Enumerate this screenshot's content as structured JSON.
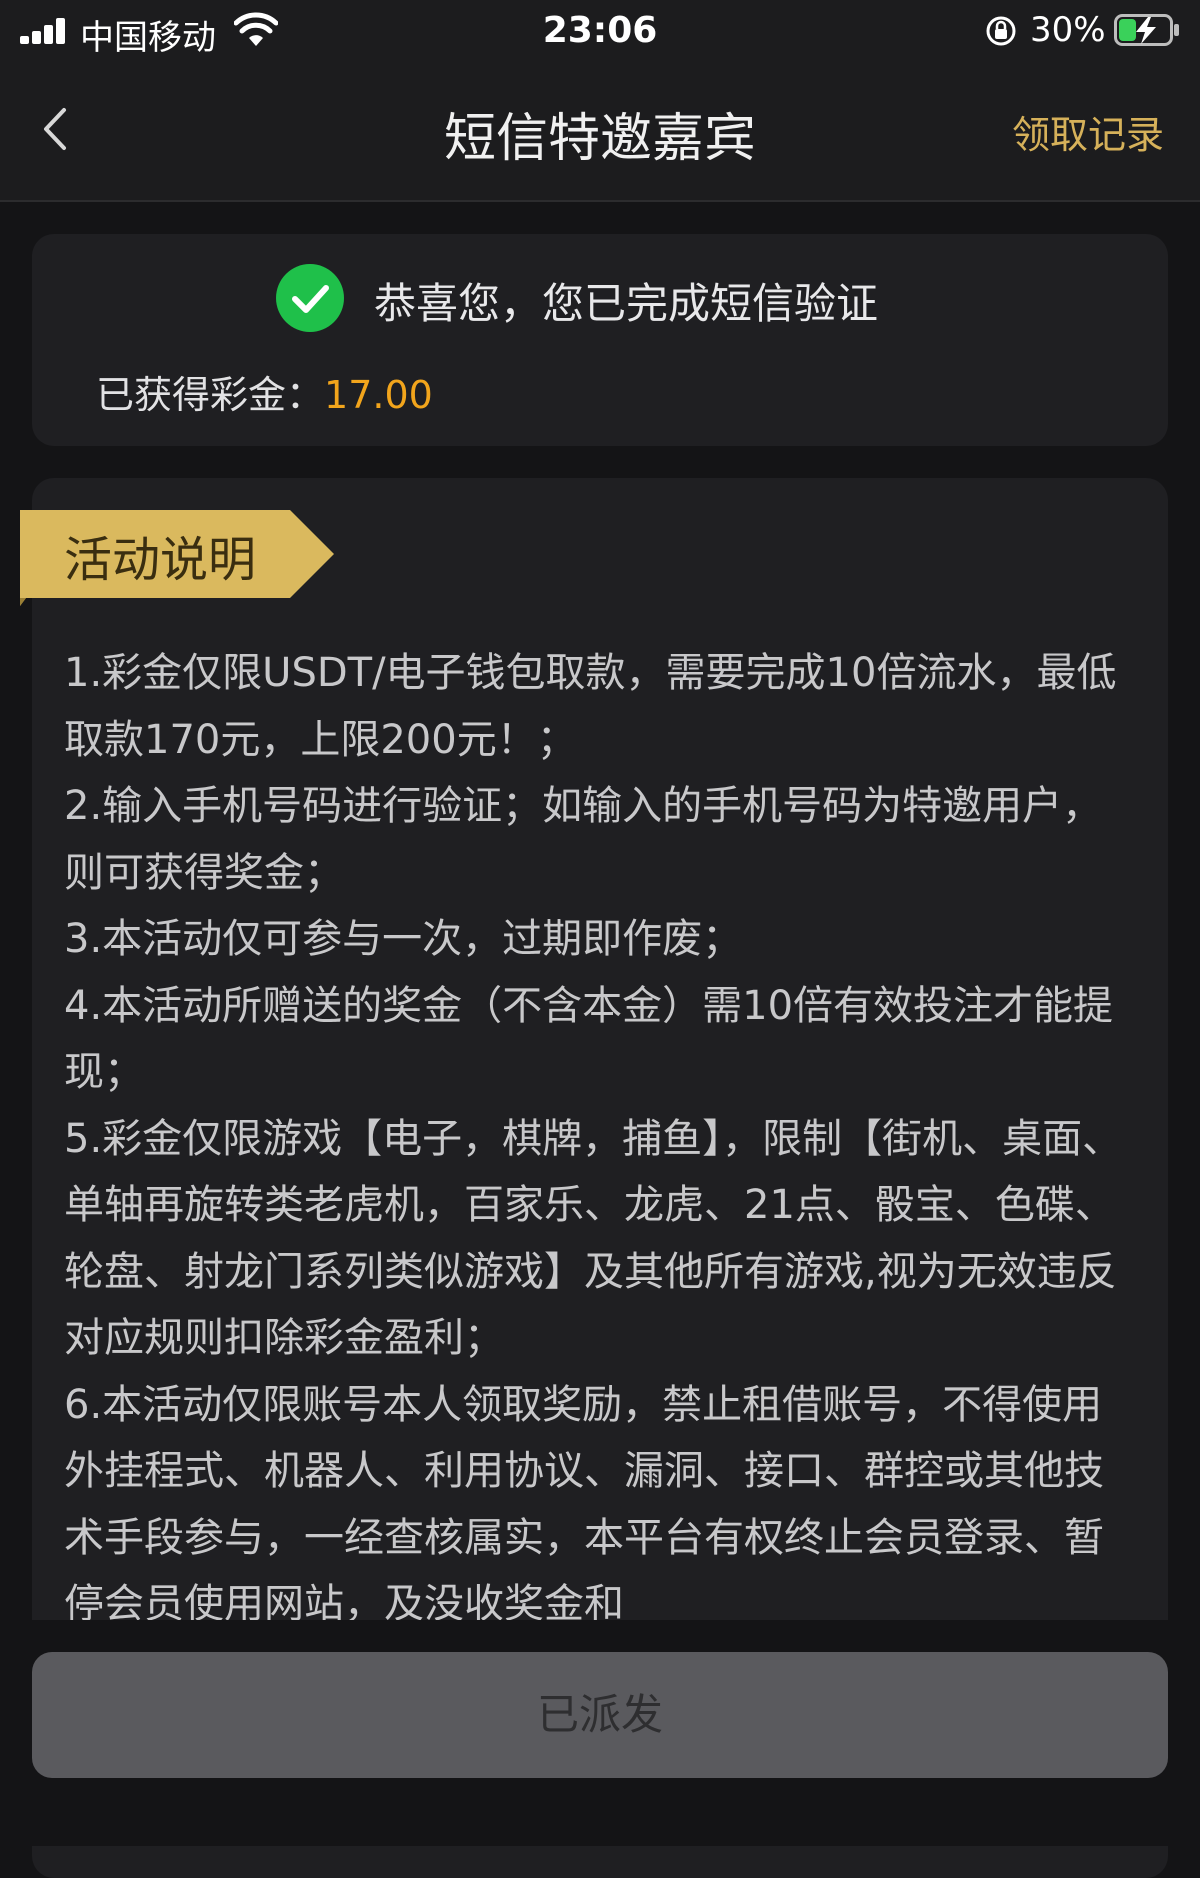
{
  "status_bar": {
    "carrier": "中国移动",
    "time": "23:06",
    "battery_percent": "30%"
  },
  "nav": {
    "title": "短信特邀嘉宾",
    "right_action": "领取记录"
  },
  "success": {
    "message": "恭喜您，您已完成短信验证",
    "bonus_label": "已获得彩金：",
    "bonus_value": "17.00"
  },
  "rules": {
    "heading": "活动说明",
    "items": [
      "1.彩金仅限USDT/电子钱包取款，需要完成10倍流水，最低取款170元，上限200元！；",
      "2.输入手机号码进行验证；如输入的手机号码为特邀用户，则可获得奖金；",
      "3.本活动仅可参与一次，过期即作废；",
      "4.本活动所赠送的奖金（不含本金）需10倍有效投注才能提现；",
      "5.彩金仅限游戏【电子，棋牌，捕鱼】，限制【街机、桌面、单轴再旋转类老虎机，百家乐、龙虎、21点、骰宝、色碟、轮盘、射龙门系列类似游戏】及其他所有游戏,视为无效违反对应规则扣除彩金盈利；",
      "6.本活动仅限账号本人领取奖励，禁止租借账号，不得使用外挂程式、机器人、利用协议、漏洞、接口、群控或其他技术手段参与，一经查核属实，本平台有权终止会员登录、暂停会员使用网站，及没收奖金和"
    ]
  },
  "footer": {
    "button_label": "已派发"
  },
  "colors": {
    "accent_gold": "#d6b15a",
    "bonus_orange": "#f2a51c",
    "success_green": "#1fc04a"
  }
}
